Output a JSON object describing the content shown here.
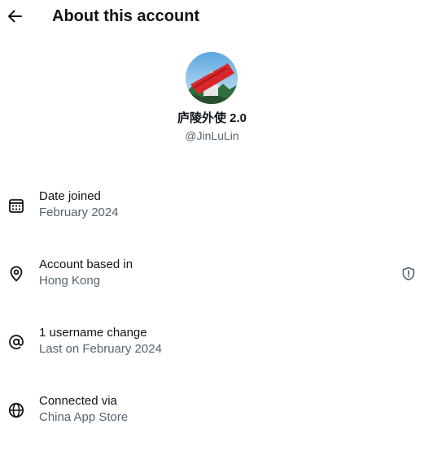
{
  "header": {
    "title": "About this account",
    "back_icon": "arrow-left-icon"
  },
  "profile": {
    "display_name": "庐陵外使 2.0",
    "handle": "@JinLuLin"
  },
  "details": [
    {
      "icon": "calendar-icon",
      "label": "Date joined",
      "value": "February 2024"
    },
    {
      "icon": "location-pin-icon",
      "label": "Account based in",
      "value": "Hong Kong",
      "trailing_icon": "shield-alert-icon"
    },
    {
      "icon": "at-sign-icon",
      "label": "1 username change",
      "value": "Last on February 2024"
    },
    {
      "icon": "globe-icon",
      "label": "Connected via",
      "value": "China App Store"
    }
  ],
  "colors": {
    "primary_text": "#0f1419",
    "secondary_text": "#536471"
  }
}
